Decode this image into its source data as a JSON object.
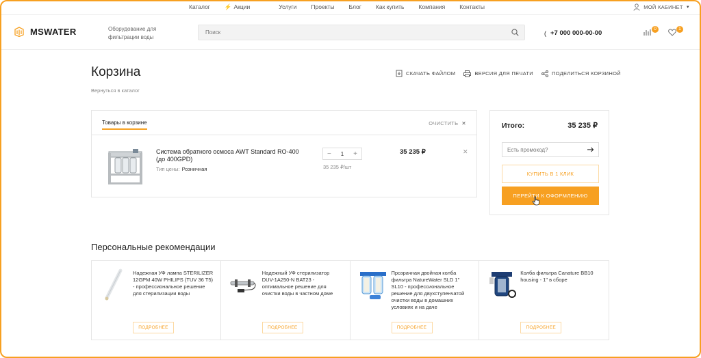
{
  "topnav": {
    "links": [
      "Каталог",
      "Акции",
      "Услуги",
      "Проекты",
      "Блог",
      "Как купить",
      "Компания",
      "Контакты"
    ],
    "cabinet": "МОЙ КАБИНЕТ"
  },
  "header": {
    "brand": "MSWATER",
    "tagline": "Оборудование для фильтрации воды",
    "search_placeholder": "Поиск",
    "phone": "+7 000 000-00-00",
    "compare_count": "0",
    "favorites_count": "1"
  },
  "page": {
    "title": "Корзина",
    "back_link": "Вернуться в каталог",
    "actions": [
      "СКАЧАТЬ ФАЙЛОМ",
      "ВЕРСИЯ ДЛЯ ПЕЧАТИ",
      "ПОДЕЛИТЬСЯ КОРЗИНОЙ"
    ]
  },
  "cart": {
    "tab": "Товары в корзине",
    "clear": "ОЧИСТИТЬ",
    "item": {
      "name": "Система обратного осмоса AWT Standard RO-400 (до 400GPD)",
      "price_type_label": "Тип цены:",
      "price_type": "Розничная",
      "quantity": "1",
      "unit_price": "35 235 ₽/шт",
      "total": "35 235 ₽"
    }
  },
  "summary": {
    "label": "Итого:",
    "total": "35 235 ₽",
    "promo_placeholder": "Есть промокод?",
    "one_click": "КУПИТЬ В 1 КЛИК",
    "checkout": "ПЕРЕЙТИ К ОФОРМЛЕНИЮ"
  },
  "recommendations": {
    "title": "Персональные рекомендации",
    "button_label": "ПОДРОБНЕЕ",
    "items": [
      {
        "name": "Надежная УФ лампа STERILIZER 12GPM 40W PHILIPS (TUV 36 T5) - профессиональное решение для стерилизации воды"
      },
      {
        "name": "Надежный УФ стерилизатор DUV-1A250-N BAT23 - оптимальное решение для очистки воды в частном доме"
      },
      {
        "name": "Прозрачная двойная колба фильтра NatureWater SLD 1\" SL10 - профессиональное решение для двухступенчатой очистки воды в домашних условиях и на даче"
      },
      {
        "name": "Колба фильтра Canature BB10 housing - 1\" в сборе"
      }
    ]
  },
  "colors": {
    "accent": "#f7a021",
    "border": "#e5e5e5"
  }
}
